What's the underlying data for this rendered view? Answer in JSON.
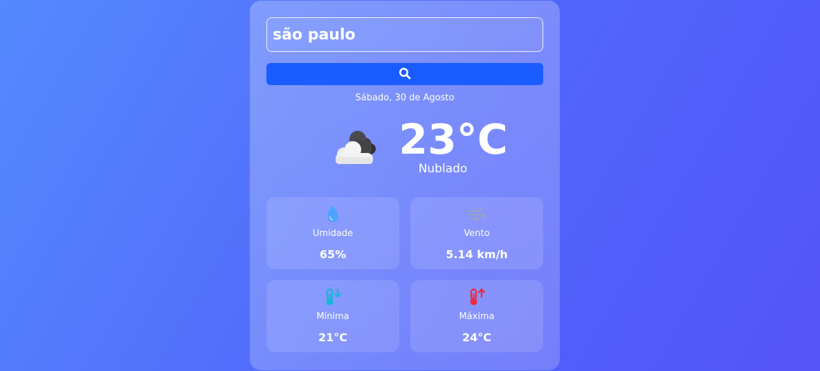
{
  "search": {
    "value": "são paulo",
    "button_icon": "search-icon"
  },
  "date": "Sábado, 30 de Agosto",
  "current": {
    "icon": "cloudy-icon",
    "temperature": "23°C",
    "condition": "Nublado"
  },
  "details": [
    {
      "icon": "water-drop-icon",
      "label": "Umidade",
      "value": "65%",
      "color": "#4aa3ff"
    },
    {
      "icon": "wind-icon",
      "label": "Vento",
      "value": "5.14 km/h",
      "color": "#9aa3c0"
    },
    {
      "icon": "thermometer-down-icon",
      "label": "Mínima",
      "value": "21°C",
      "color": "#14b8d8"
    },
    {
      "icon": "thermometer-up-icon",
      "label": "Máxima",
      "value": "24°C",
      "color": "#ee2a3b"
    }
  ],
  "colors": {
    "accent": "#1a5cff",
    "background_start": "#5589ff",
    "background_end": "#5454f7"
  }
}
